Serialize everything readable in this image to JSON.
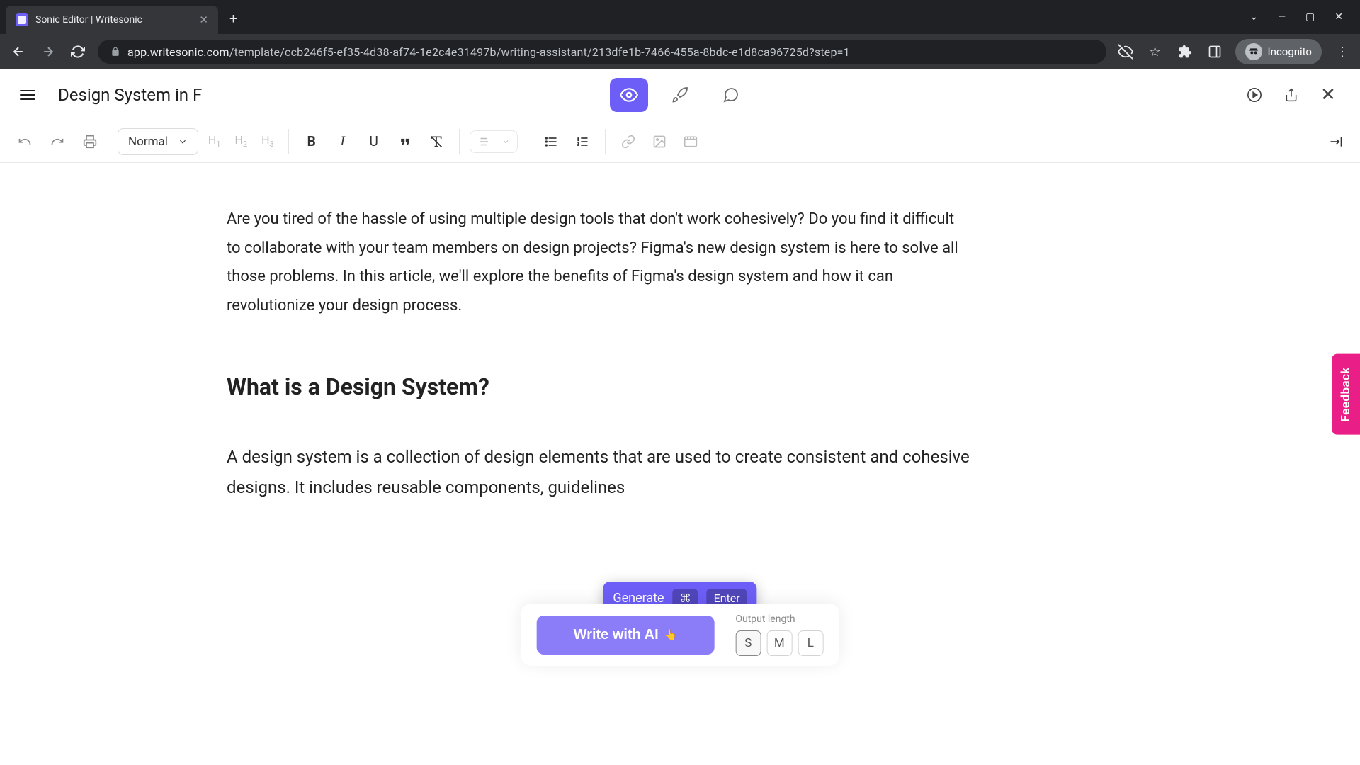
{
  "browser": {
    "tab_title": "Sonic Editor | Writesonic",
    "url_domain": "app.writesonic.com",
    "url_path": "/template/ccb246f5-ef35-4d38-af74-1e2c4e31497b/writing-assistant/213dfe1b-7466-455a-8bdc-e1d8ca96725d?step=1",
    "incognito_label": "Incognito"
  },
  "header": {
    "doc_title": "Design System in F"
  },
  "toolbar": {
    "style": "Normal",
    "h1": "H",
    "h1s": "1",
    "h2": "H",
    "h2s": "2",
    "h3": "H",
    "h3s": "3"
  },
  "content": {
    "para1": "Are you tired of the hassle of using multiple design tools that don't work cohesively? Do you find it difficult to collaborate with your team members on design projects? Figma's new design system is here to solve all those problems. In this article, we'll explore the benefits of Figma's design system and how it can revolutionize your design process.",
    "heading": "What is a Design System?",
    "para2": "A design system is a collection of design elements that are used to create consistent and cohesive designs. It includes reusable components, guidelines"
  },
  "tooltip": {
    "label": "Generate",
    "key1": "⌘",
    "key2": "Enter"
  },
  "actions": {
    "write_label": "Write with AI",
    "out_len_label": "Output length",
    "opts": {
      "s": "S",
      "m": "M",
      "l": "L"
    }
  },
  "feedback": "Feedback"
}
